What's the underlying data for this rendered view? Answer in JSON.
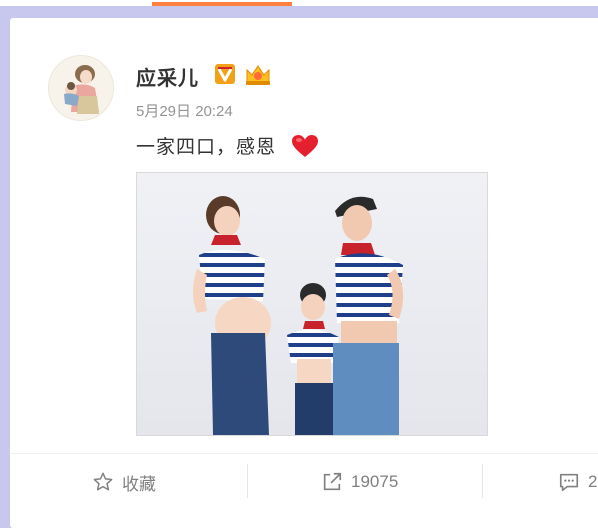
{
  "post": {
    "username": "应采儿",
    "timestamp": "5月29日 20:24",
    "text": "一家四口，感恩",
    "emoji_icon": "red-heart-icon",
    "badges": [
      "verified-v-icon",
      "crown-member-icon"
    ]
  },
  "actions": {
    "favorite_label": "收藏",
    "repost_count": "19075",
    "comment_count": "2"
  },
  "colors": {
    "background": "#c8c8ee",
    "accent_tab": "#ff8140",
    "verified_badge": "#f2a016",
    "heart": "#e5202e"
  }
}
